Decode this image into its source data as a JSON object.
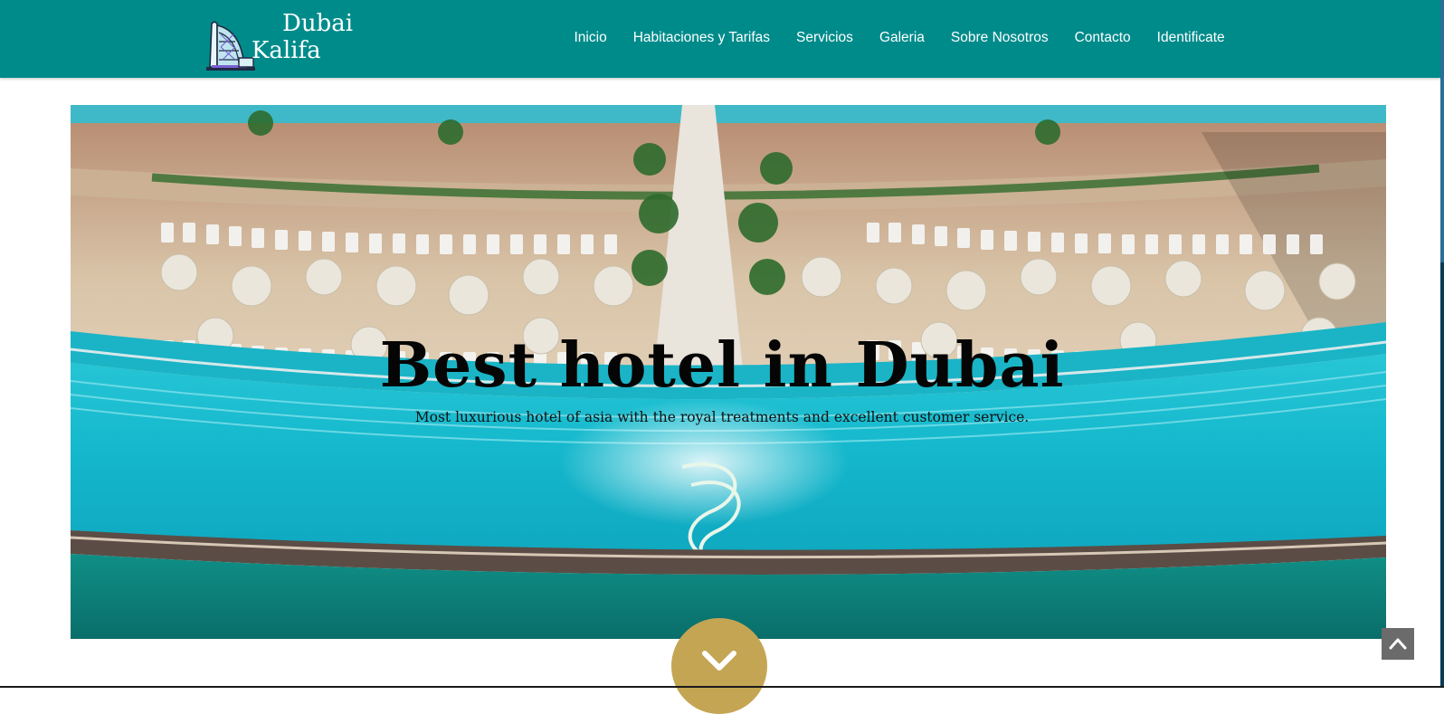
{
  "brand": {
    "line1": "Dubai",
    "line2": "Kalifa",
    "logo_icon": "burj-al-arab-logo-icon"
  },
  "nav": {
    "items": [
      {
        "label": "Inicio"
      },
      {
        "label": "Habitaciones y Tarifas"
      },
      {
        "label": "Servicios"
      },
      {
        "label": "Galeria"
      },
      {
        "label": "Sobre Nosotros"
      },
      {
        "label": "Contacto"
      },
      {
        "label": "Identificate"
      }
    ]
  },
  "hero": {
    "title": "Best hotel in Dubai",
    "subtitle": "Most luxurious hotel of asia with the royal treatments and excellent customer service."
  },
  "controls": {
    "scroll_down_icon": "chevron-down-icon",
    "back_to_top_icon": "chevron-up-icon"
  },
  "colors": {
    "navbar": "#008b8b",
    "scroll_button": "#c4a554",
    "pool": "#1fc3d3",
    "sand": "#d8c2a6"
  }
}
